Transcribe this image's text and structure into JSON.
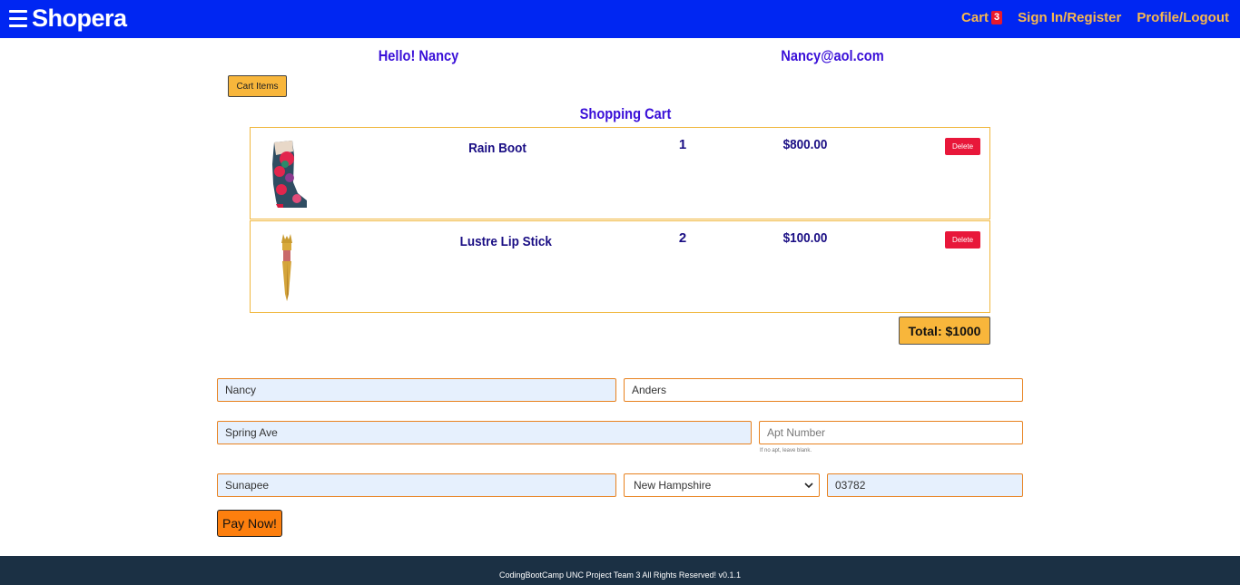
{
  "nav": {
    "brand": "Shopera",
    "cart_label": "Cart",
    "cart_count": "3",
    "signin_label": "Sign In/Register",
    "profile_label": "Profile/Logout"
  },
  "user": {
    "greeting": "Hello! Nancy",
    "email": "Nancy@aol.com"
  },
  "cart_items_button": "Cart Items",
  "cart_title": "Shopping Cart",
  "items": [
    {
      "name": "Rain Boot",
      "qty": "1",
      "price": "$800.00",
      "delete_label": "Delete",
      "icon": "boot-image"
    },
    {
      "name": "Lustre Lip Stick",
      "qty": "2",
      "price": "$100.00",
      "delete_label": "Delete",
      "icon": "lipstick-image"
    }
  ],
  "total": "Total: $1000",
  "form": {
    "first_name": "Nancy",
    "last_name": "Anders",
    "street": "Spring Ave",
    "apt_placeholder": "Apt Number",
    "apt_hint": "If no apt, leave blank.",
    "city": "Sunapee",
    "state": "New Hampshire",
    "zip": "03782"
  },
  "pay_button": "Pay Now!",
  "footer": "CodingBootCamp UNC Project Team 3 All Rights Reserved! v0.1.1",
  "colors": {
    "navbar": "#0026f2",
    "nav_link": "#f8b84e",
    "badge": "#e8192c",
    "heading": "#3a10d8",
    "item_text": "#1a0e84",
    "accent_button": "#f8b63b",
    "delete": "#e8173a",
    "pay": "#fd7f0e",
    "footer": "#1b3044"
  }
}
